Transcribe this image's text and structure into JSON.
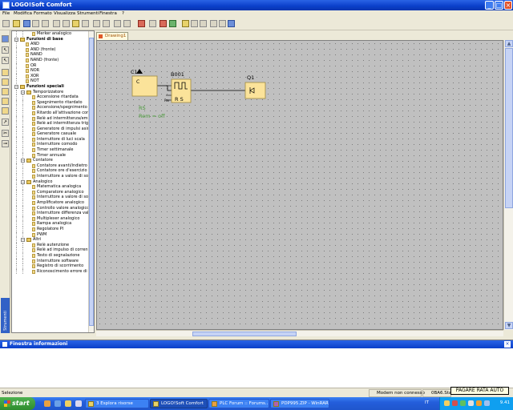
{
  "window": {
    "title": "LOGO!Soft Comfort"
  },
  "menu": [
    "File",
    "Modifica",
    "Formato",
    "Visualizza",
    "Strumenti",
    "Finestra",
    "?"
  ],
  "drawing_tab": "Drawing1",
  "tree": [
    {
      "label": "Merker analogico",
      "type": "block",
      "level": 2
    },
    {
      "label": "Funzioni di base",
      "type": "category",
      "level": 0
    },
    {
      "label": "AND",
      "type": "block",
      "level": 1
    },
    {
      "label": "AND (fronte)",
      "type": "block",
      "level": 1
    },
    {
      "label": "NAND",
      "type": "block",
      "level": 1
    },
    {
      "label": "NAND (fronte)",
      "type": "block",
      "level": 1
    },
    {
      "label": "OR",
      "type": "block",
      "level": 1
    },
    {
      "label": "NOR",
      "type": "block",
      "level": 1
    },
    {
      "label": "XOR",
      "type": "block",
      "level": 1
    },
    {
      "label": "NOT",
      "type": "block",
      "level": 1
    },
    {
      "label": "Funzioni speciali",
      "type": "category",
      "level": 0
    },
    {
      "label": "Temporizzatore",
      "type": "folder",
      "level": 1
    },
    {
      "label": "Accensione ritardata",
      "type": "block",
      "level": 2
    },
    {
      "label": "Spegnimento ritardato",
      "type": "block",
      "level": 2
    },
    {
      "label": "Accensione/spegnimento ri",
      "type": "block",
      "level": 2
    },
    {
      "label": "Ritardo all'attivazione con m",
      "type": "block",
      "level": 2
    },
    {
      "label": "Relè ad intermittenza/emis",
      "type": "block",
      "level": 2
    },
    {
      "label": "Relè ad intermittenza trigg",
      "type": "block",
      "level": 2
    },
    {
      "label": "Generatore di impulsi asinc",
      "type": "block",
      "level": 2
    },
    {
      "label": "Generatore casuale",
      "type": "block",
      "level": 2
    },
    {
      "label": "Interruttore di luci scala",
      "type": "block",
      "level": 2
    },
    {
      "label": "Interruttore comodo",
      "type": "block",
      "level": 2
    },
    {
      "label": "Timer settimanale",
      "type": "block",
      "level": 2
    },
    {
      "label": "Timer annuale",
      "type": "block",
      "level": 2
    },
    {
      "label": "Contatore",
      "type": "folder",
      "level": 1
    },
    {
      "label": "Contatore avanti/indietro",
      "type": "block",
      "level": 2
    },
    {
      "label": "Contatore ore d'esercizio",
      "type": "block",
      "level": 2
    },
    {
      "label": "Interruttore a valore di soç",
      "type": "block",
      "level": 2
    },
    {
      "label": "Analogico",
      "type": "folder",
      "level": 1
    },
    {
      "label": "Matematica analogica",
      "type": "block",
      "level": 2
    },
    {
      "label": "Comparatore analogico",
      "type": "block",
      "level": 2
    },
    {
      "label": "Interruttore a valore di soç",
      "type": "block",
      "level": 2
    },
    {
      "label": "Amplificatore analogico",
      "type": "block",
      "level": 2
    },
    {
      "label": "Controllo valore analogico",
      "type": "block",
      "level": 2
    },
    {
      "label": "Interruttore differenza vali",
      "type": "block",
      "level": 2
    },
    {
      "label": "Multiplexer analogico",
      "type": "block",
      "level": 2
    },
    {
      "label": "Rampa analogica",
      "type": "block",
      "level": 2
    },
    {
      "label": "Regolatore PI",
      "type": "block",
      "level": 2
    },
    {
      "label": "PWM",
      "type": "block",
      "level": 2
    },
    {
      "label": "Altri",
      "type": "folder",
      "level": 1
    },
    {
      "label": "Relè autenzione",
      "type": "block",
      "level": 2
    },
    {
      "label": "Relè ad impulso di corrente",
      "type": "block",
      "level": 2
    },
    {
      "label": "Testo di segnalazione",
      "type": "block",
      "level": 2
    },
    {
      "label": "Interruttore software",
      "type": "block",
      "level": 2
    },
    {
      "label": "Registro di scorrimento",
      "type": "block",
      "level": 2
    },
    {
      "label": "Riconoscimento errore di a",
      "type": "block",
      "level": 2
    }
  ],
  "side_tab": "Strumenti",
  "diagram": {
    "c1_label": "C1",
    "c1_symbol": "C",
    "b001_label": "B001",
    "b001_rs": "R S",
    "b001_par": "Par",
    "q1_label": "Q1",
    "remark_1": "RS",
    "remark_2": "Rem = off"
  },
  "info_panel": {
    "title": "Finestra informazioni"
  },
  "status": {
    "left": "Selezione",
    "modem": "Modem non connesso",
    "device": "0BA6.Star"
  },
  "tooltip": "PAGARE RATA AUTO",
  "taskbar": {
    "start": "start",
    "tasks": [
      {
        "label": "3 Esplora risorse",
        "active": false
      },
      {
        "label": "LOGO!Soft Comfort",
        "active": true
      },
      {
        "label": "PLC Forum :: Forums...",
        "active": false
      },
      {
        "label": "PDP995.ZIP - WinRAR",
        "active": false
      }
    ],
    "lang": "IT",
    "clock": "9.41"
  },
  "colors": {
    "accent": "#0a3fc9",
    "canvas": "#c0c0c0",
    "block_fill": "#fbe39a",
    "remark": "#4a9a3a"
  }
}
